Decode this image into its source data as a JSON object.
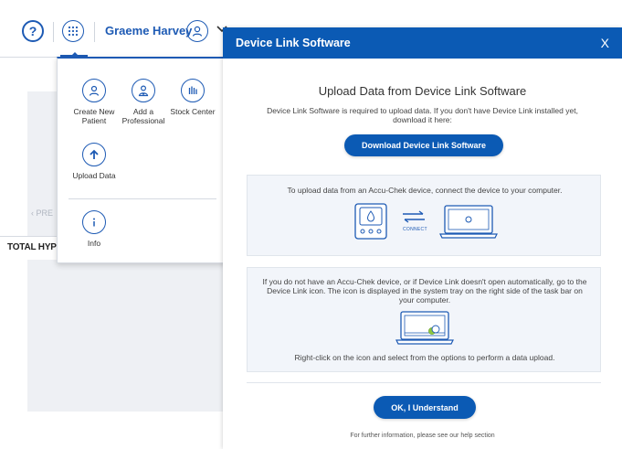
{
  "header": {
    "help_symbol": "?",
    "user_name": "Graeme Harvey"
  },
  "background": {
    "prev_label": "PRE",
    "total_label": "TOTAL HYP"
  },
  "menu": {
    "items": [
      {
        "label": "Create New Patient",
        "icon": "user-add-icon"
      },
      {
        "label": "Add a Professional",
        "icon": "professional-icon"
      },
      {
        "label": "Stock Center",
        "icon": "stock-icon"
      },
      {
        "label": "Upload Data",
        "icon": "upload-icon"
      },
      {
        "label": "Info",
        "icon": "info-icon"
      }
    ]
  },
  "modal": {
    "title": "Device Link Software",
    "close_symbol": "X",
    "heading": "Upload Data from Device Link Software",
    "intro": "Device Link Software is required to upload data. If you don't have Device Link installed yet, download it here:",
    "download_button": "Download Device Link Software",
    "box1_text": "To upload data from an Accu-Chek device, connect the device to your computer.",
    "connect_label": "CONNECT",
    "box2_text": "If you do not have an Accu-Chek device, or if Device Link doesn't open automatically, go to the Device Link icon. The icon is displayed in the system tray on the right side of the task bar on your computer.",
    "box2_instruction": "Right-click on the icon and select from the options to perform a data upload.",
    "ok_button": "OK, I Understand",
    "footer": "For further information, please see our help section"
  },
  "colors": {
    "primary": "#0b5ab4",
    "box_bg": "#f2f5fa",
    "accent_green": "#8dc63f"
  }
}
